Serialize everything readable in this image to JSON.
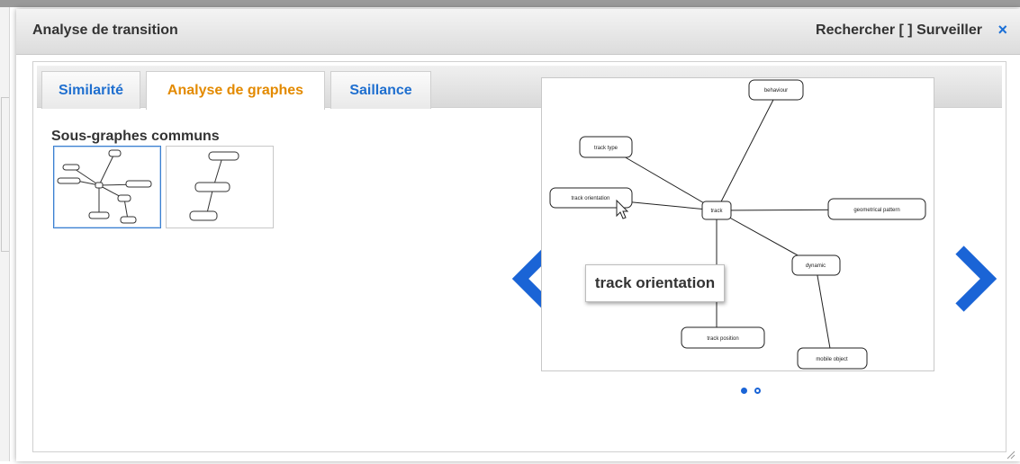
{
  "dialog": {
    "title": "Analyse de transition",
    "right_title": "Rechercher [ ] Surveiller",
    "close_glyph": "×"
  },
  "tabs": [
    {
      "label": "Similarité",
      "active": false
    },
    {
      "label": "Analyse de graphes",
      "active": true
    },
    {
      "label": "Saillance",
      "active": false
    }
  ],
  "panel": {
    "subgraphs_title": "Sous-graphes communs"
  },
  "graph": {
    "center_node": "track",
    "nodes": [
      "behaviour",
      "track type",
      "track orientation",
      "track",
      "geometrical pattern",
      "dynamic",
      "track position",
      "mobile object"
    ]
  },
  "tooltip": {
    "text": "track orientation"
  },
  "carousel": {
    "current_page": 1,
    "total_pages": 2
  },
  "colors": {
    "accent": "#1f6fcf",
    "active_tab": "#e38a00",
    "arrow": "#1a64d6"
  }
}
